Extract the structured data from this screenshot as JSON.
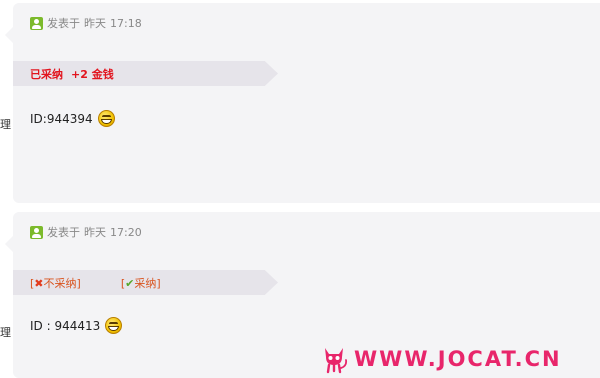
{
  "posts": [
    {
      "side_char": "理",
      "meta": {
        "prefix": "发表于",
        "date": "昨天",
        "time": "17:18"
      },
      "status": {
        "accepted": "已采纳",
        "reward": "+2 金钱"
      },
      "content": "ID:944394"
    },
    {
      "side_char": "理",
      "meta": {
        "prefix": "发表于",
        "date": "昨天",
        "time": "17:20"
      },
      "actions": {
        "reject": "不采纳",
        "accept": "采纳"
      },
      "content": "ID : 944413"
    }
  ],
  "watermark": {
    "text": "WWW.JOCAT.CN"
  },
  "colors": {
    "accent_red": "#e2141e",
    "action_orange": "#d9531e",
    "online_green": "#7cba2c",
    "watermark_pink": "#e8266b"
  }
}
